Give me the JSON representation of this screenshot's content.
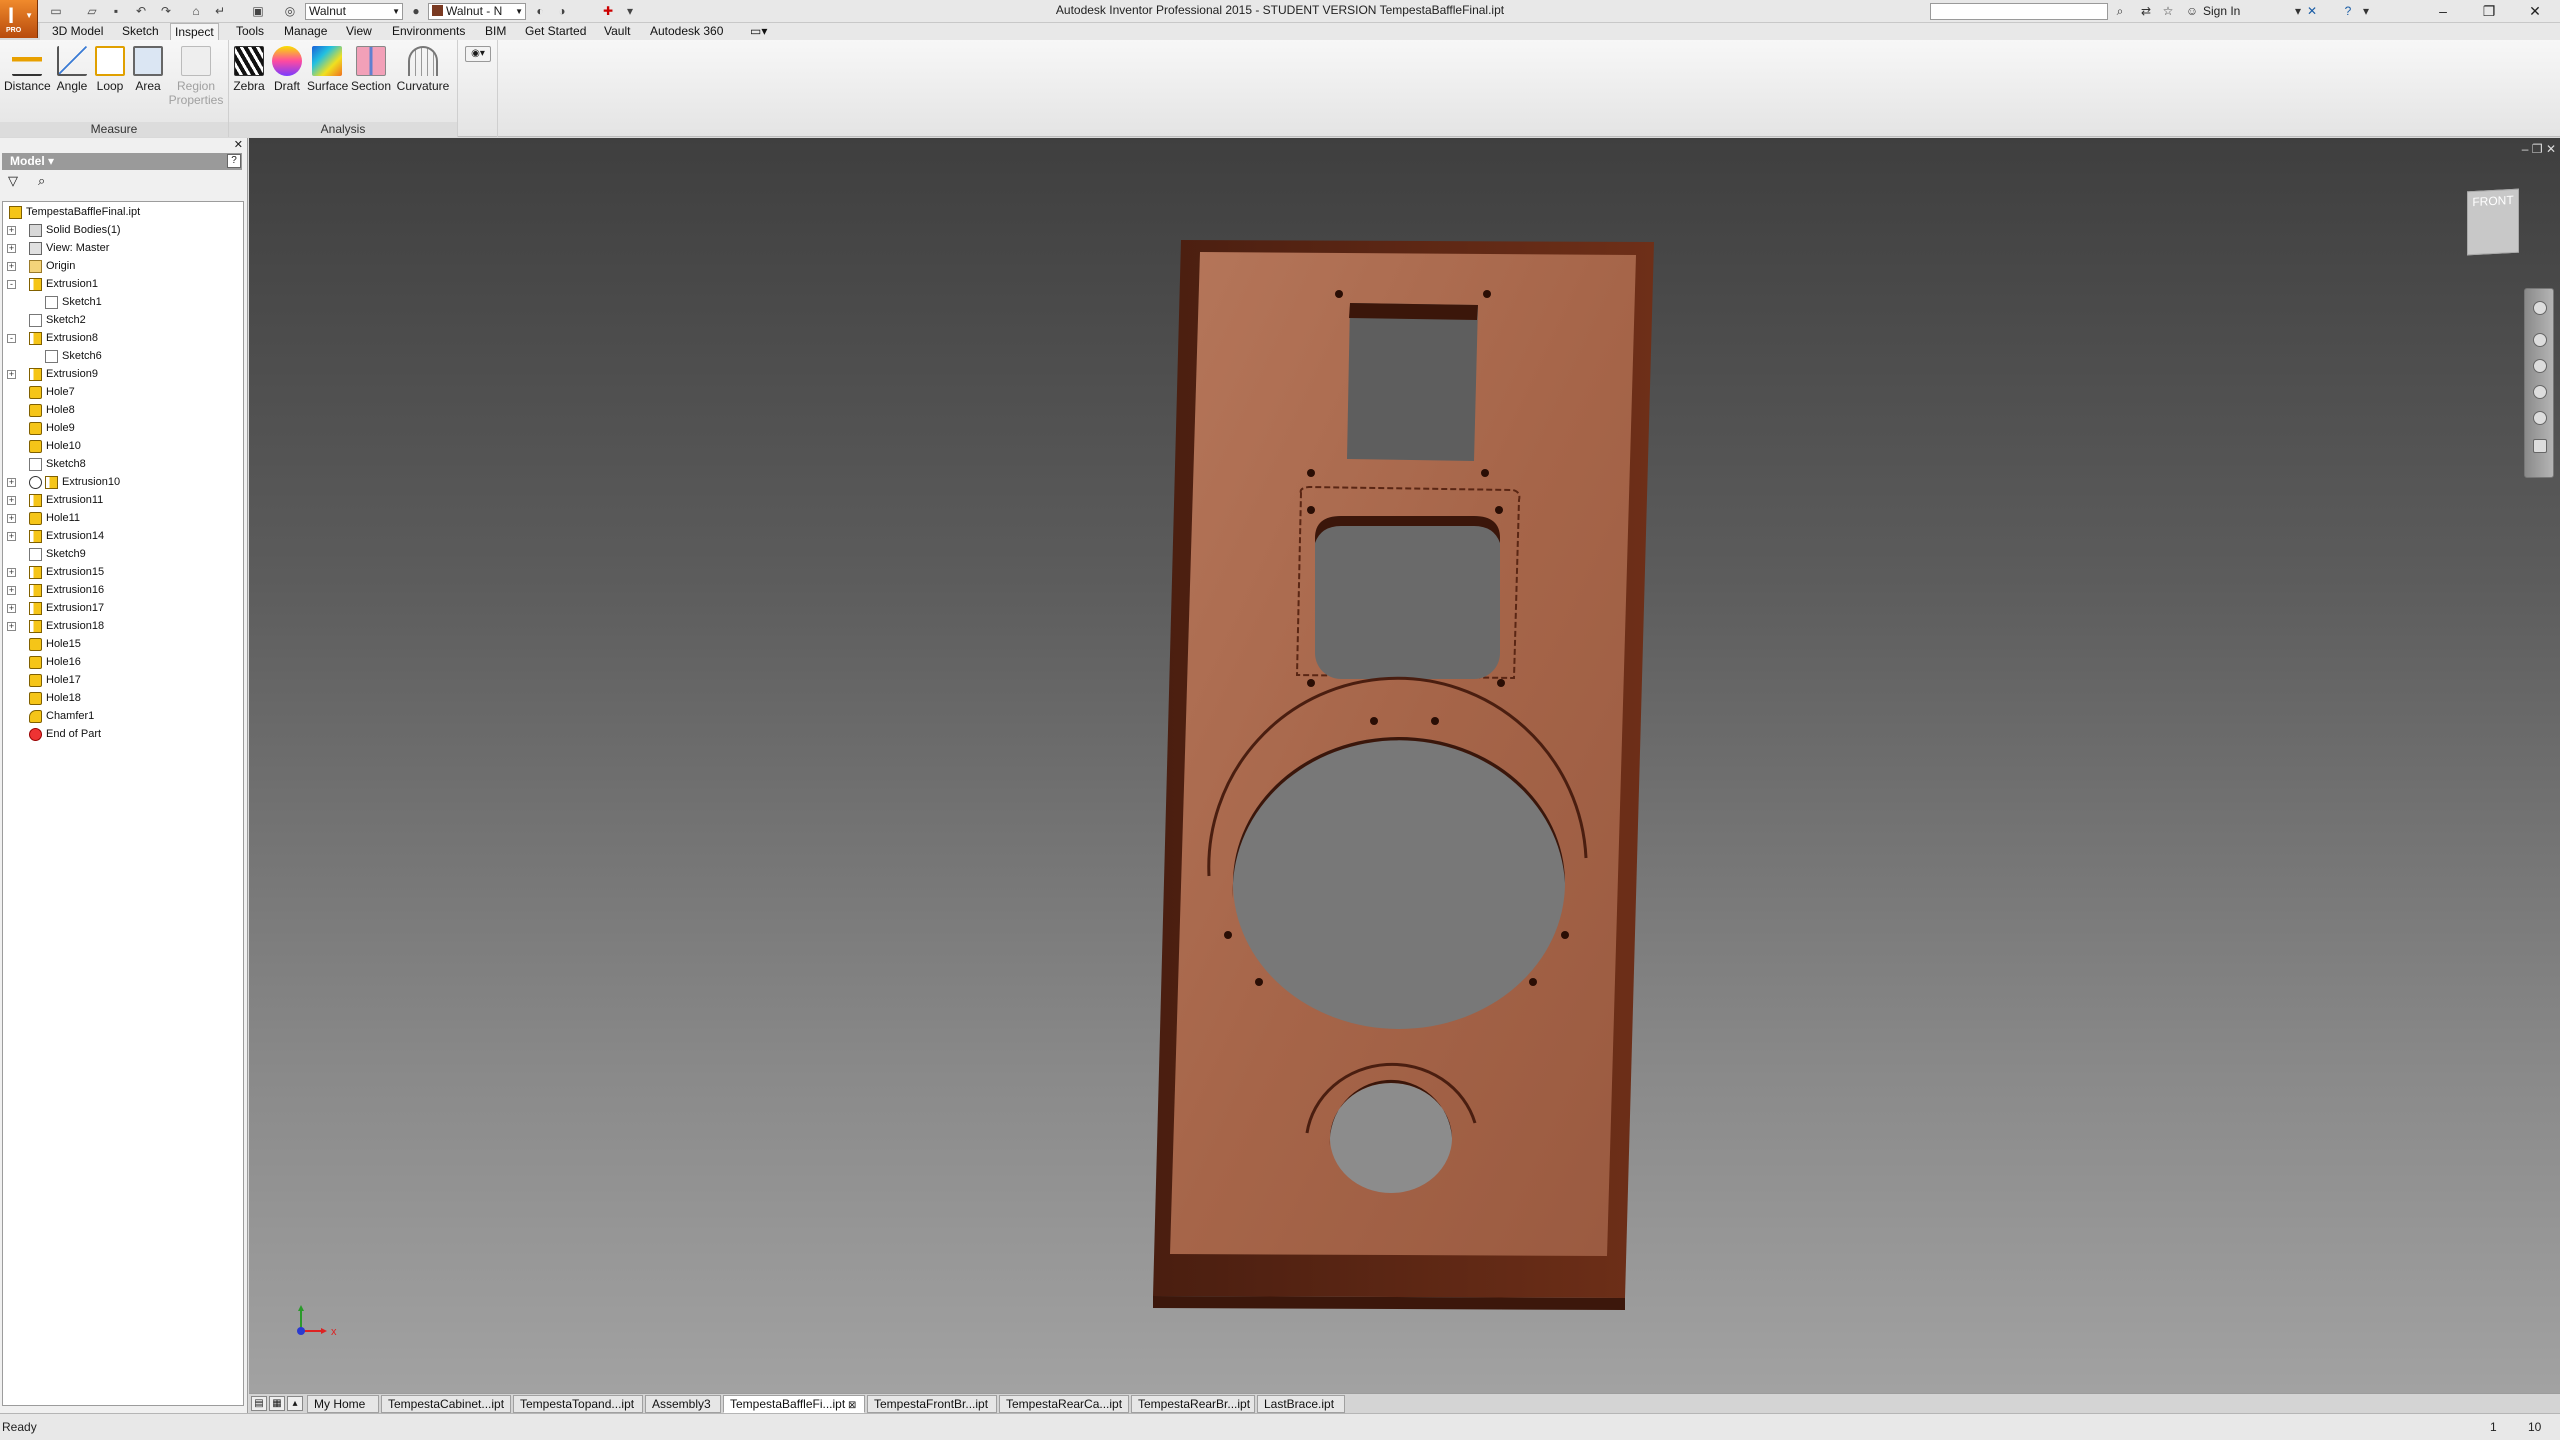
{
  "app": {
    "window_title": "Autodesk Inventor Professional 2015 - STUDENT VERSION    TempestaBaffleFinal.ipt",
    "app_button_letter": "I",
    "app_button_badge": "PRO",
    "accent": "#e07020"
  },
  "quick_access": {
    "material_value": "Walnut",
    "appearance_value": "Walnut - N",
    "appearance_swatch": "#7a3a22"
  },
  "top_right": {
    "search_placeholder": "",
    "sign_in": "Sign In",
    "icons": [
      "binoculars-icon",
      "exchange-icon",
      "star-icon",
      "user-icon",
      "x-autodesk-icon",
      "help-icon"
    ]
  },
  "ribbon": {
    "tabs": [
      "3D Model",
      "Sketch",
      "Inspect",
      "Tools",
      "Manage",
      "View",
      "Environments",
      "BIM",
      "Get Started",
      "Vault",
      "Autodesk 360"
    ],
    "active_tab": "Inspect",
    "panels": {
      "measure": {
        "label": "Measure",
        "buttons": [
          "Distance",
          "Angle",
          "Loop",
          "Area",
          "Region Properties"
        ]
      },
      "analysis": {
        "label": "Analysis",
        "buttons": [
          "Zebra",
          "Draft",
          "Surface",
          "Section",
          "Curvature"
        ]
      }
    }
  },
  "browser": {
    "title": "Model",
    "tree": [
      {
        "label": "TempestaBaffleFinal.ipt",
        "icon": "part",
        "level": 0,
        "expander": ""
      },
      {
        "label": "Solid Bodies(1)",
        "icon": "solid",
        "level": 1,
        "expander": "+"
      },
      {
        "label": "View: Master",
        "icon": "view",
        "level": 1,
        "expander": "+"
      },
      {
        "label": "Origin",
        "icon": "folder",
        "level": 1,
        "expander": "+"
      },
      {
        "label": "Extrusion1",
        "icon": "extrude",
        "level": 1,
        "expander": "-"
      },
      {
        "label": "Sketch1",
        "icon": "sketch",
        "level": 2,
        "expander": ""
      },
      {
        "label": "Sketch2",
        "icon": "sketch",
        "level": 1,
        "expander": ""
      },
      {
        "label": "Extrusion8",
        "icon": "extrude",
        "level": 1,
        "expander": "-"
      },
      {
        "label": "Sketch6",
        "icon": "sketch",
        "level": 2,
        "expander": ""
      },
      {
        "label": "Extrusion9",
        "icon": "extrude",
        "level": 1,
        "expander": "+"
      },
      {
        "label": "Hole7",
        "icon": "hole",
        "level": 1,
        "expander": ""
      },
      {
        "label": "Hole8",
        "icon": "hole",
        "level": 1,
        "expander": ""
      },
      {
        "label": "Hole9",
        "icon": "hole",
        "level": 1,
        "expander": ""
      },
      {
        "label": "Hole10",
        "icon": "hole",
        "level": 1,
        "expander": ""
      },
      {
        "label": "Sketch8",
        "icon": "sketch",
        "level": 1,
        "expander": ""
      },
      {
        "label": "Extrusion10",
        "icon": "extrude",
        "level": 1,
        "expander": "+",
        "suppressed": true
      },
      {
        "label": "Extrusion11",
        "icon": "extrude",
        "level": 1,
        "expander": "+"
      },
      {
        "label": "Hole11",
        "icon": "hole",
        "level": 1,
        "expander": "+"
      },
      {
        "label": "Extrusion14",
        "icon": "extrude",
        "level": 1,
        "expander": "+"
      },
      {
        "label": "Sketch9",
        "icon": "sketch",
        "level": 1,
        "expander": ""
      },
      {
        "label": "Extrusion15",
        "icon": "extrude",
        "level": 1,
        "expander": "+"
      },
      {
        "label": "Extrusion16",
        "icon": "extrude",
        "level": 1,
        "expander": "+"
      },
      {
        "label": "Extrusion17",
        "icon": "extrude",
        "level": 1,
        "expander": "+"
      },
      {
        "label": "Extrusion18",
        "icon": "extrude",
        "level": 1,
        "expander": "+"
      },
      {
        "label": "Hole15",
        "icon": "hole",
        "level": 1,
        "expander": ""
      },
      {
        "label": "Hole16",
        "icon": "hole",
        "level": 1,
        "expander": ""
      },
      {
        "label": "Hole17",
        "icon": "hole",
        "level": 1,
        "expander": ""
      },
      {
        "label": "Hole18",
        "icon": "hole",
        "level": 1,
        "expander": ""
      },
      {
        "label": "Chamfer1",
        "icon": "chamfer",
        "level": 1,
        "expander": ""
      },
      {
        "label": "End of Part",
        "icon": "end",
        "level": 1,
        "expander": ""
      }
    ]
  },
  "viewport": {
    "viewcube_label": "FRONT",
    "triad_x": "x",
    "material_color": "#a8684c",
    "edge_color": "#5a2614"
  },
  "document_tabs": {
    "items": [
      "My Home",
      "TempestaCabinet...ipt",
      "TempestaTopand...ipt",
      "Assembly3",
      "TempestaBaffleFi...ipt",
      "TempestaFrontBr...ipt",
      "TempestaRearCa...ipt",
      "TempestaRearBr...ipt",
      "LastBrace.ipt"
    ],
    "active": "TempestaBaffleFi...ipt"
  },
  "status": {
    "text": "Ready",
    "value_1": "1",
    "value_2": "10"
  }
}
